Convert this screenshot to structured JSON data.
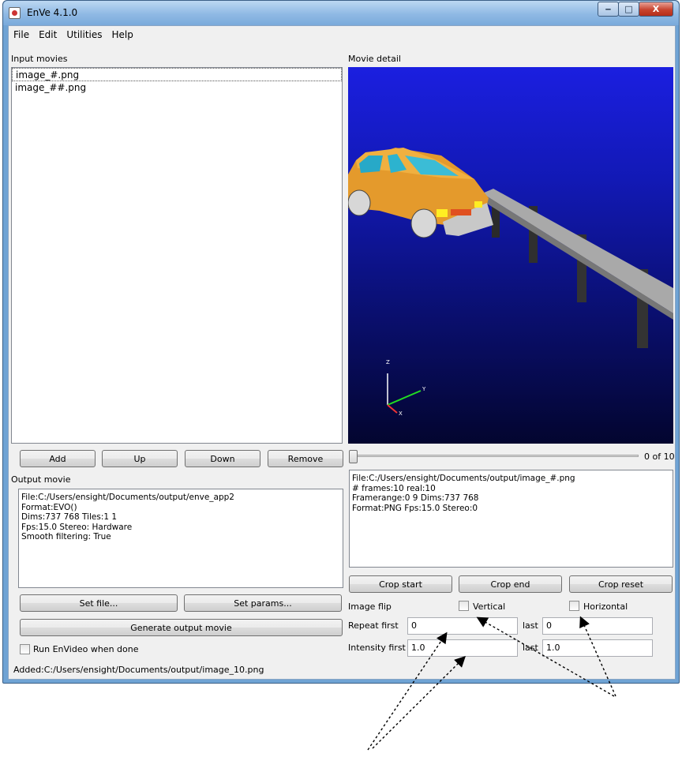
{
  "window": {
    "title": "EnVe 4.1.0",
    "min_label": "‒",
    "max_label": "□",
    "close_label": "X"
  },
  "menu": [
    "File",
    "Edit",
    "Utilities",
    "Help"
  ],
  "input_movies": {
    "label": "Input movies",
    "items": [
      "image_#.png",
      "image_##.png"
    ],
    "buttons": {
      "add": "Add",
      "up": "Up",
      "down": "Down",
      "remove": "Remove"
    }
  },
  "movie_detail": {
    "label": "Movie detail",
    "frame_counter": "0 of 10",
    "info": "File:C:/Users/ensight/Documents/output/image_#.png\n# frames:10 real:10\nFramerange:0 9 Dims:737 768\nFormat:PNG Fps:15.0 Stereo:0",
    "axis_labels": {
      "z": "Z",
      "y": "Y",
      "x": "X"
    }
  },
  "output_movie": {
    "label": "Output movie",
    "info": "File:C:/Users/ensight/Documents/output/enve_app2\nFormat:EVO()\nDims:737 768 Tiles:1 1\nFps:15.0 Stereo: Hardware\nSmooth filtering: True",
    "set_file": "Set file...",
    "set_params": "Set params...",
    "generate": "Generate output movie",
    "run_envideo": "Run EnVideo when done"
  },
  "crop": {
    "start": "Crop start",
    "end": "Crop end",
    "reset": "Crop reset"
  },
  "image_flip": {
    "label": "Image flip",
    "vertical": "Vertical",
    "horizontal": "Horizontal"
  },
  "repeat": {
    "label": "Repeat first",
    "first": "0",
    "last_label": "last",
    "last": "0"
  },
  "intensity": {
    "label": "Intensity first",
    "first": "1.0",
    "last_label": "last",
    "last": "1.0"
  },
  "status": "Added:C:/Users/ensight/Documents/output/image_10.png"
}
